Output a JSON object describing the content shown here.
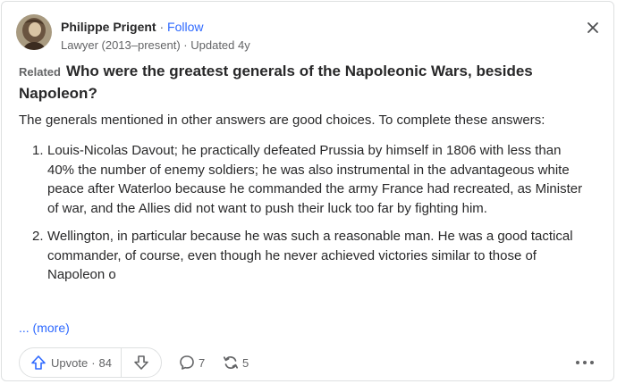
{
  "author": {
    "name": "Philippe Prigent",
    "separator": "·",
    "follow_label": "Follow",
    "credential": "Lawyer (2013–present) · Updated 4y",
    "avatar_icon": "portrait-avatar"
  },
  "question": {
    "tag": "Related",
    "title": "Who were the greatest generals of the Napoleonic Wars, besides Napoleon?"
  },
  "answer": {
    "intro": "The generals mentioned in other answers are good choices. To complete these answers:",
    "items": [
      {
        "number": "1.",
        "text": "Louis-Nicolas Davout; he practically defeated Prussia by himself in 1806 with less than 40% the number of enemy soldiers; he was also instrumental in the advantageous white peace after Waterloo because he commanded the army France had recreated, as Minister of war, and the Allies did not want to push their luck too far by fighting him."
      },
      {
        "number": "2.",
        "text": "Wellington, in particular because he was such a reasonable man. He was a good tactical commander, of course, even though he never achieved victories similar to those of Napoleon o"
      }
    ],
    "more_label": "... (more)"
  },
  "actions": {
    "upvote_label": "Upvote",
    "upvote_separator": "·",
    "upvote_count": "84",
    "comments_count": "7",
    "shares_count": "5"
  },
  "colors": {
    "accent": "#2e69ff",
    "text": "#282829",
    "muted": "#636466",
    "border": "#dee0e1"
  },
  "icons": [
    "close-icon",
    "upvote-arrow-icon",
    "downvote-arrow-icon",
    "comment-icon",
    "share-icon",
    "more-options-icon"
  ]
}
